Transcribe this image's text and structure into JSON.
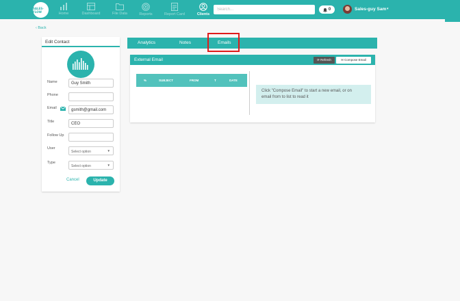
{
  "app": {
    "logo_text": "SALES-FLOW"
  },
  "nav": {
    "items": [
      {
        "label": "Home",
        "icon": "bar-chart-icon"
      },
      {
        "label": "Dashboard",
        "icon": "dashboard-icon"
      },
      {
        "label": "File Data",
        "icon": "folder-icon"
      },
      {
        "label": "Reports",
        "icon": "target-icon"
      },
      {
        "label": "Report Card",
        "icon": "report-card-icon"
      },
      {
        "label": "Clients",
        "icon": "user-circle-icon",
        "active": true
      }
    ]
  },
  "search": {
    "placeholder": "Search..."
  },
  "notifications": {
    "count": "0"
  },
  "user": {
    "name": "Sales-guy Sam",
    "caret": "▾"
  },
  "back": {
    "label": "‹ Back"
  },
  "contact": {
    "title": "Edit Contact",
    "fields": {
      "name": {
        "label": "Name",
        "value": "Guy Smith"
      },
      "phone": {
        "label": "Phone",
        "value": ""
      },
      "email": {
        "label": "Email",
        "value": "gsmith@gmail.com"
      },
      "title": {
        "label": "Title",
        "value": "CEO"
      },
      "follow_up": {
        "label": "Follow Up",
        "value": ""
      },
      "user": {
        "label": "User",
        "value": "Select option"
      },
      "type": {
        "label": "Type",
        "value": "Select option"
      }
    },
    "cancel_label": "Cancel",
    "update_label": "Update"
  },
  "tabs": {
    "analytics": "Analytics",
    "notes": "Notes",
    "emails": "Emails"
  },
  "email_panel": {
    "title": "External Email",
    "refresh_label": "Refresh",
    "compose_label": "Compose Email",
    "columns": {
      "pct": "%",
      "subject": "SUBJECT",
      "from": "FROM",
      "t": "T",
      "date": "DATE"
    },
    "info_line1": "Click \"Compose Email\" to start a new email, or on",
    "info_line2": "email from to list to read it"
  },
  "colors": {
    "accent": "#2bb3ad",
    "highlight": "#e01b1b"
  }
}
